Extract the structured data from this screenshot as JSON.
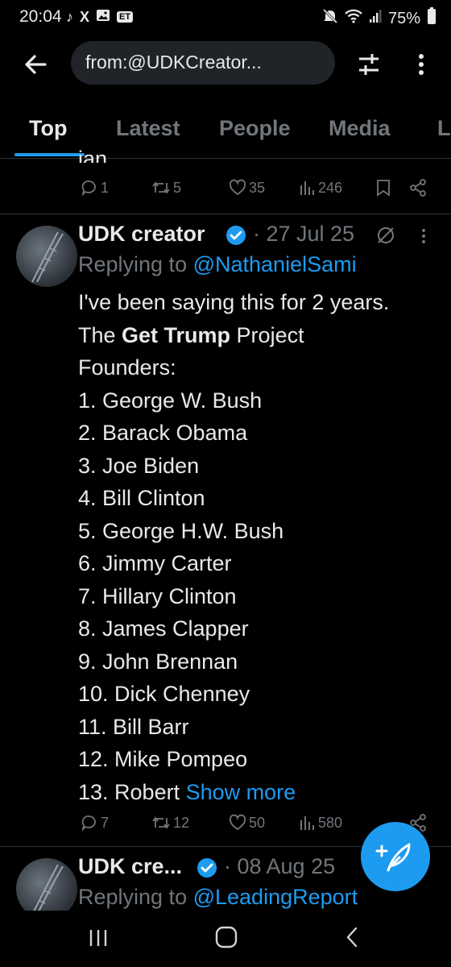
{
  "status_bar": {
    "time": "20:04",
    "battery": "75%",
    "left_icons": [
      "tiktok-icon",
      "x-icon",
      "image-icon",
      "et-icon"
    ],
    "et_label": "ET",
    "right_icons": [
      "mute-icon",
      "wifi-icon",
      "signal-icon",
      "battery-icon"
    ]
  },
  "header": {
    "search_query": "from:@UDKCreator..."
  },
  "tabs": [
    {
      "label": "Top",
      "active": true
    },
    {
      "label": "Latest",
      "active": false
    },
    {
      "label": "People",
      "active": false
    },
    {
      "label": "Media",
      "active": false
    },
    {
      "label": "L",
      "active": false
    }
  ],
  "prev_tweet": {
    "partial_text": "jan.",
    "replies": "1",
    "reposts": "5",
    "likes": "35",
    "views": "246"
  },
  "tweet1": {
    "name": "UDK creator",
    "date": "· 27 Jul 25",
    "replying_prefix": "Replying to ",
    "replying_to": "@NathanielSami",
    "lines": [
      "I've been saying this for 2 years.",
      "",
      "Founders:",
      "1. George W. Bush",
      "2. Barack Obama",
      "3. Joe Biden",
      "4. Bill Clinton",
      "5. George H.W. Bush",
      "6. Jimmy Carter",
      "7. Hillary Clinton",
      "8. James Clapper",
      "9. John Brennan",
      "10. Dick Chenney",
      "11. Bill Barr",
      "12. Mike Pompeo"
    ],
    "line2_prefix": "The ",
    "line2_bold": "Get Trump",
    "line2_suffix": " Project",
    "last_line_text": "13. Robert ",
    "show_more": "Show more",
    "replies": "7",
    "reposts": "12",
    "likes": "50",
    "views": "580"
  },
  "tweet2": {
    "name": "UDK cre...",
    "date": "· 08 Aug 25",
    "replying_prefix": "Replying to ",
    "replying_to": "@LeadingReport"
  },
  "colors": {
    "background": "#000000",
    "text": "#e7e9ea",
    "muted": "#71767b",
    "accent": "#1d9bf0",
    "divider": "#2f3336"
  }
}
